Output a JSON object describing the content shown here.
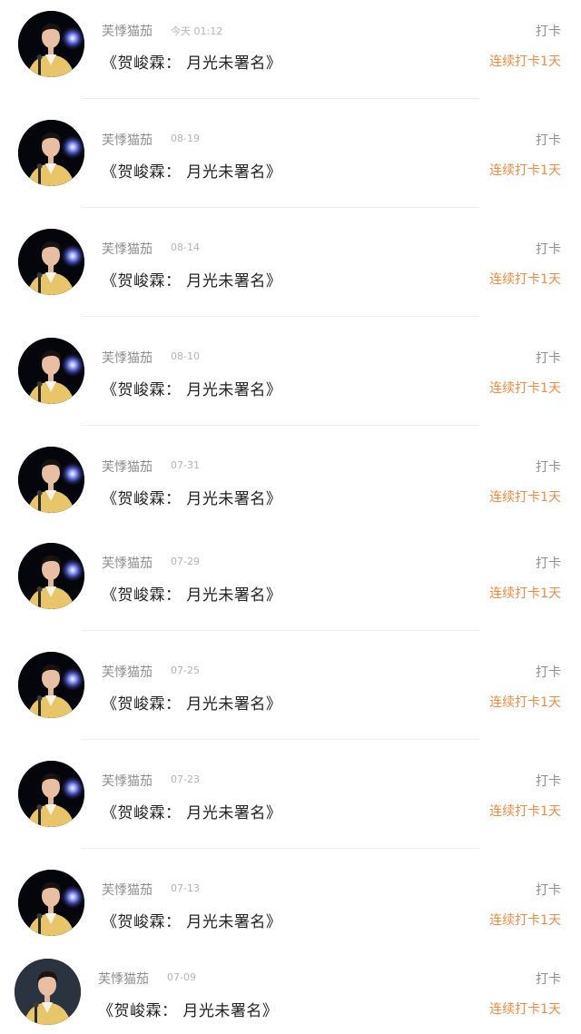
{
  "items": [
    {
      "user": "芙悸猫茄",
      "date": "今天 01:12",
      "title": "《贺峻霖： 月光未署名》",
      "action": "打卡",
      "streak": "连续打卡1天"
    },
    {
      "user": "芙悸猫茄",
      "date": "08-19",
      "title": "《贺峻霖： 月光未署名》",
      "action": "打卡",
      "streak": "连续打卡1天"
    },
    {
      "user": "芙悸猫茄",
      "date": "08-14",
      "title": "《贺峻霖： 月光未署名》",
      "action": "打卡",
      "streak": "连续打卡1天"
    },
    {
      "user": "芙悸猫茄",
      "date": "08-10",
      "title": "《贺峻霖： 月光未署名》",
      "action": "打卡",
      "streak": "连续打卡1天"
    },
    {
      "user": "芙悸猫茄",
      "date": "07-31",
      "title": "《贺峻霖： 月光未署名》",
      "action": "打卡",
      "streak": "连续打卡1天"
    },
    {
      "user": "芙悸猫茄",
      "date": "07-29",
      "title": "《贺峻霖： 月光未署名》",
      "action": "打卡",
      "streak": "连续打卡1天"
    },
    {
      "user": "芙悸猫茄",
      "date": "07-25",
      "title": "《贺峻霖： 月光未署名》",
      "action": "打卡",
      "streak": "连续打卡1天"
    },
    {
      "user": "芙悸猫茄",
      "date": "07-23",
      "title": "《贺峻霖： 月光未署名》",
      "action": "打卡",
      "streak": "连续打卡1天"
    },
    {
      "user": "芙悸猫茄",
      "date": "07-13",
      "title": "《贺峻霖： 月光未署名》",
      "action": "打卡",
      "streak": "连续打卡1天"
    },
    {
      "user": "芙悸猫茄",
      "date": "07-09",
      "title": "《贺峻霖： 月光未署名》",
      "action": "打卡",
      "streak": "连续打卡1天"
    }
  ],
  "colors": {
    "streak": "#f08a3e",
    "muted": "#8e8e8e",
    "title": "#222222"
  }
}
